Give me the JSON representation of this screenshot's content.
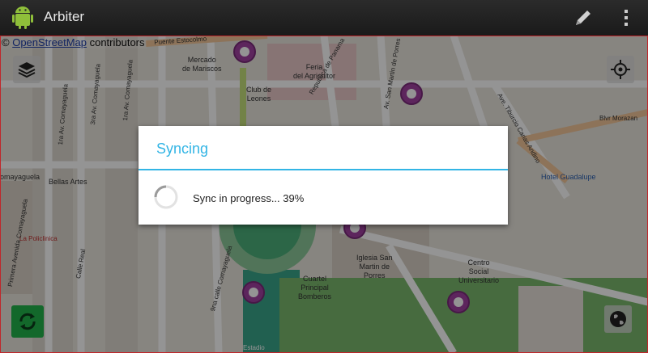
{
  "app": {
    "title": "Arbiter",
    "edit_icon": "pencil-icon",
    "menu_icon": "overflow-menu-icon"
  },
  "map": {
    "attribution_link": "OpenStreetMap",
    "attribution_suffix": " contributors",
    "labels": {
      "mercado": [
        "Mercado",
        "de Mariscos"
      ],
      "feria": [
        "Feria",
        "del Agricultor"
      ],
      "club": [
        "Club de",
        "Leones"
      ],
      "puente": "Puente Estocolmo",
      "republica": "Republica de Panama",
      "san_martin": "Av. San Martin de Porres",
      "tiburcio": "Ave. Tiburcio Carias Andino",
      "morazan": "Blvr Morazan",
      "hotel": "Hotel Guadalupe",
      "comayaguela1": "1ra Av. Comayaguela",
      "comayaguela3": "3ra Av. Comayaguela",
      "comayaguela1b": "1ra Av. Comayaguela",
      "bellas": "Bellas Artes",
      "comayaguela_west": "omayaguela",
      "policlinica": "La Policlinica",
      "calle_real": "Calle Real",
      "primera_av": "Primera Avenida Comayaguela",
      "novena": "9na calle Comayaguela",
      "iglesia": [
        "Iglesia San",
        "Martin de",
        "Porres"
      ],
      "cuartel": [
        "Cuartel",
        "Principal",
        "Bomberos"
      ],
      "centro": [
        "Centro",
        "Social",
        "Universitario"
      ],
      "estadio": "Estadio"
    }
  },
  "dialog": {
    "title": "Syncing",
    "message": "Sync in progress... 39%",
    "progress_percent": 39
  },
  "colors": {
    "accent": "#33b5e5",
    "sync_button": "#21b34b",
    "frame": "#c0262a"
  }
}
